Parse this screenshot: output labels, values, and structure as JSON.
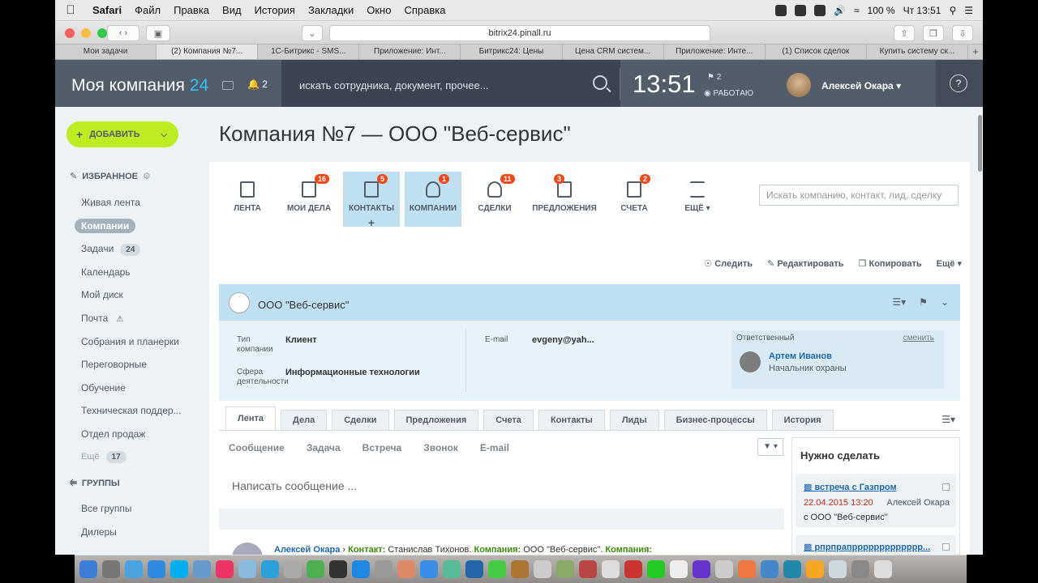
{
  "menubar": {
    "app": "Safari",
    "items": [
      "Файл",
      "Правка",
      "Вид",
      "История",
      "Закладки",
      "Окно",
      "Справка"
    ],
    "battery": "100 %",
    "clock": "Чт 13:51"
  },
  "browser": {
    "url": "bitrix24.pinall.ru",
    "tabs": [
      "Мои задачи",
      "(2) Компания №7...",
      "1С-Битрикс - SMS...",
      "Приложение: Инт...",
      "Битрикс24: Цены",
      "Цена CRM систем...",
      "Приложение: Инте...",
      "(1) Список сделок",
      "Купить систему ск..."
    ],
    "active_tab": 1
  },
  "header": {
    "logo": "Моя компания",
    "logo_num": "24",
    "notif_count": "2",
    "search_placeholder": "искать сотрудника, документ, прочее...",
    "time": "13:51",
    "flag_count": "2",
    "status": "РАБОТАЮ",
    "user": "Алексей Окара",
    "help": "?"
  },
  "sidebar": {
    "add": "ДОБАВИТЬ",
    "fav": "ИЗБРАННОЕ",
    "items": [
      {
        "label": "Живая лента"
      },
      {
        "label": "Компании"
      },
      {
        "label": "Задачи",
        "count": "24"
      },
      {
        "label": "Календарь"
      },
      {
        "label": "Мой диск"
      },
      {
        "label": "Почта"
      },
      {
        "label": "Собрания и планерки"
      },
      {
        "label": "Переговорные"
      },
      {
        "label": "Обучение"
      },
      {
        "label": "Техническая поддер..."
      },
      {
        "label": "Отдел продаж"
      },
      {
        "label": "Ещё",
        "count": "17"
      }
    ],
    "groups": "ГРУППЫ",
    "group_items": [
      "Все группы",
      "Дилеры"
    ]
  },
  "page": {
    "title": "Компания №7 — ООО \"Веб-сервис\""
  },
  "crmnav": [
    {
      "label": "ЛЕНТА",
      "badge": ""
    },
    {
      "label": "МОИ ДЕЛА",
      "badge": "16"
    },
    {
      "label": "КОНТАКТЫ",
      "badge": "5"
    },
    {
      "label": "КОМПАНИИ",
      "badge": "1"
    },
    {
      "label": "СДЕЛКИ",
      "badge": "11"
    },
    {
      "label": "ПРЕДЛОЖЕНИЯ",
      "badge": "3"
    },
    {
      "label": "СЧЕТА",
      "badge": "2"
    },
    {
      "label": "ЕЩЁ",
      "badge": ""
    }
  ],
  "crm_search": "Искать компанию, контакт, лид, сделку",
  "actions": [
    "Следить",
    "Редактировать",
    "Копировать",
    "Ещё"
  ],
  "card": {
    "name": "ООО \"Веб-сервис\"",
    "type_label": "Тип компании",
    "type_value": "Клиент",
    "sphere_label": "Сфера деятельности",
    "sphere_value": "Информационные технологии",
    "email_label": "E-mail",
    "email_value": "evgeny@yah...",
    "resp_label": "Ответственный",
    "resp_change": "сменить",
    "resp_name": "Артем Иванов",
    "resp_position": "Начальник охраны"
  },
  "tabs": [
    "Лента",
    "Дела",
    "Сделки",
    "Предложения",
    "Счета",
    "Контакты",
    "Лиды",
    "Бизнес-процессы",
    "История"
  ],
  "feed_types": [
    "Сообщение",
    "Задача",
    "Встреча",
    "Звонок",
    "E-mail"
  ],
  "compose": "Написать сообщение ...",
  "post": {
    "user": "Алексей Окара",
    "contact_label": "Контакт:",
    "contact": "Станислав Тихонов.",
    "company_label": "Компания:",
    "company": "ООО \"Веб-сервис\".",
    "company_label2": "Компания:"
  },
  "todo": {
    "title": "Нужно сделать",
    "items": [
      {
        "title": "встреча с Газпром",
        "date": "22.04.2015 13:20",
        "author": "Алексей Окара",
        "subject": "с ООО \"Веб-сервис\""
      },
      {
        "title": "рпрпрапррррррррррррр..."
      }
    ]
  }
}
